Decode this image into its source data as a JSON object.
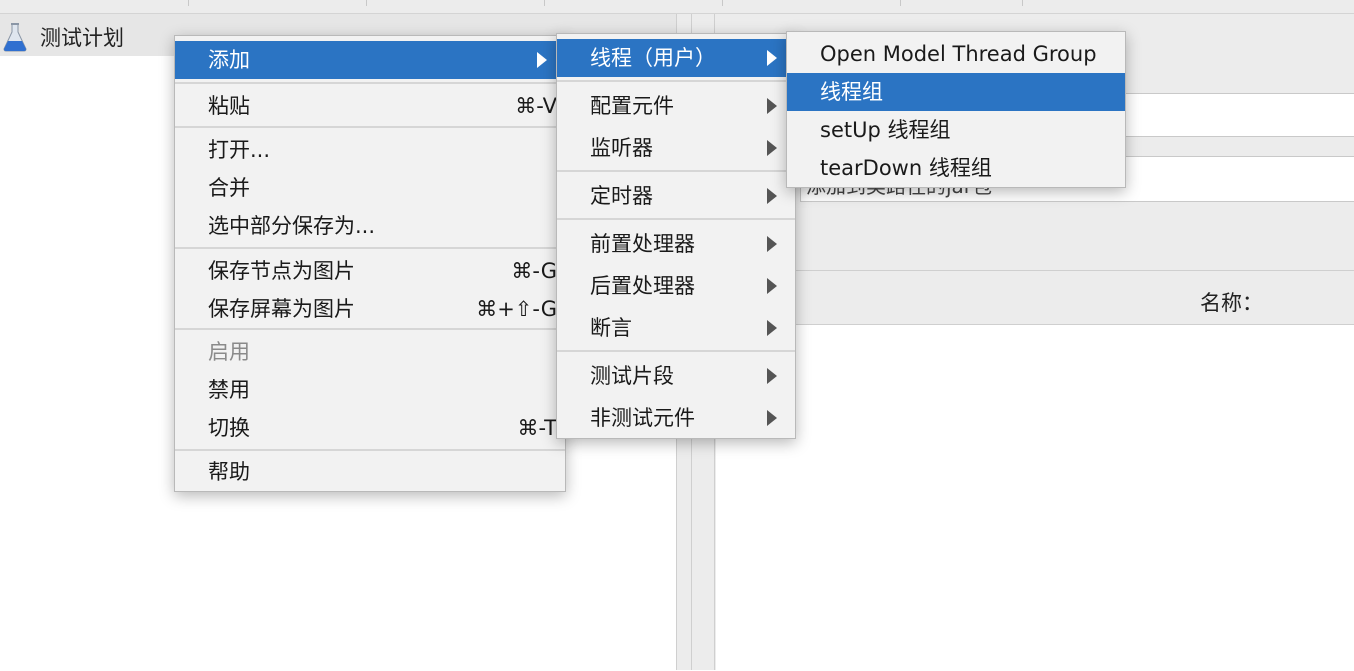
{
  "tree": {
    "root_label": "测试计划"
  },
  "right_panel": {
    "name_label": "名称：",
    "field_b_text": "添加到类路径的jar包"
  },
  "context_menu": {
    "add": "添加",
    "paste": "粘贴",
    "paste_shortcut": "⌘-V",
    "open": "打开...",
    "merge": "合并",
    "save_selection_as": "选中部分保存为...",
    "save_node_as_image": "保存节点为图片",
    "save_node_shortcut": "⌘-G",
    "save_screen_as_image": "保存屏幕为图片",
    "save_screen_shortcut": "⌘+⇧-G",
    "enable": "启用",
    "disable": "禁用",
    "toggle": "切换",
    "toggle_shortcut": "⌘-T",
    "help": "帮助"
  },
  "add_submenu": {
    "threads_users": "线程（用户）",
    "config_element": "配置元件",
    "listener": "监听器",
    "timer": "定时器",
    "pre_processor": "前置处理器",
    "post_processor": "后置处理器",
    "assertion": "断言",
    "test_fragment": "测试片段",
    "non_test_elements": "非测试元件"
  },
  "threads_submenu": {
    "open_model_thread_group": "Open Model Thread Group",
    "thread_group": "线程组",
    "setup_thread_group": "setUp 线程组",
    "teardown_thread_group": "tearDown 线程组"
  },
  "colors": {
    "highlight": "#2b74c3",
    "menu_bg": "#f2f2f2"
  }
}
